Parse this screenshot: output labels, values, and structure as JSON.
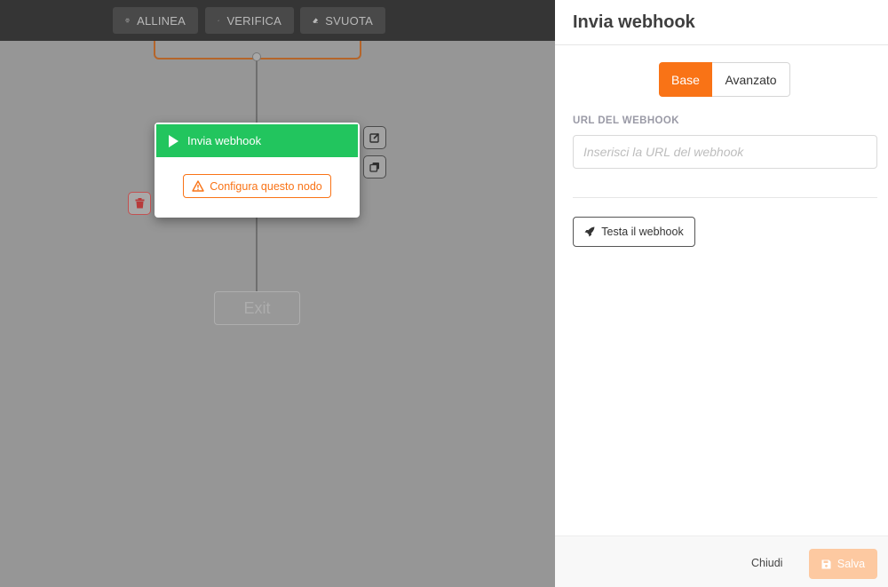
{
  "toolbar": {
    "align_label": "ALLINEA",
    "verify_label": "VERIFICA",
    "clear_label": "SVUOTA"
  },
  "canvas": {
    "node": {
      "title": "Invia webhook",
      "warning": "Configura questo nodo",
      "color": "#22c55e"
    },
    "exit_label": "Exit"
  },
  "panel": {
    "title": "Invia webhook",
    "tabs": [
      {
        "label": "Base",
        "active": true
      },
      {
        "label": "Avanzato",
        "active": false
      }
    ],
    "url_label": "URL DEL WEBHOOK",
    "url_placeholder": "Inserisci la URL del webhook",
    "url_value": "",
    "test_button": "Testa il webhook",
    "close_button": "Chiudi",
    "save_button": "Salva",
    "accent_color": "#f97316"
  }
}
